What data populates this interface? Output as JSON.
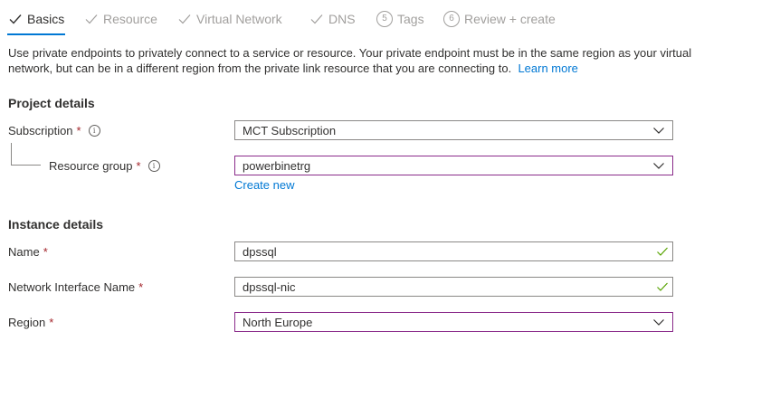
{
  "steps": [
    {
      "label": "Basics",
      "marker": "check",
      "active": true
    },
    {
      "label": "Resource",
      "marker": "check",
      "active": false
    },
    {
      "label": "Virtual Network",
      "marker": "check",
      "active": false
    },
    {
      "label": "DNS",
      "marker": "check",
      "active": false
    },
    {
      "label": "Tags",
      "marker": "5",
      "active": false
    },
    {
      "label": "Review + create",
      "marker": "6",
      "active": false
    }
  ],
  "description": {
    "text": "Use private endpoints to privately connect to a service or resource. Your private endpoint must be in the same region as your virtual network, but can be in a different region from the private link resource that you are connecting to.",
    "link": "Learn more"
  },
  "project_details": {
    "heading": "Project details",
    "subscription": {
      "label": "Subscription",
      "required": "*",
      "value": "MCT Subscription"
    },
    "resource_group": {
      "label": "Resource group",
      "required": "*",
      "value": "powerbinetrg",
      "create_new": "Create new"
    }
  },
  "instance_details": {
    "heading": "Instance details",
    "name": {
      "label": "Name",
      "required": "*",
      "value": "dpssql"
    },
    "nic_name": {
      "label": "Network Interface Name",
      "required": "*",
      "value": "dpssql-nic"
    },
    "region": {
      "label": "Region",
      "required": "*",
      "value": "North Europe"
    }
  },
  "colors": {
    "accent": "#0078d4",
    "required": "#a4262c",
    "valid": "#57a300",
    "focus_border": "#8a2b8a"
  }
}
